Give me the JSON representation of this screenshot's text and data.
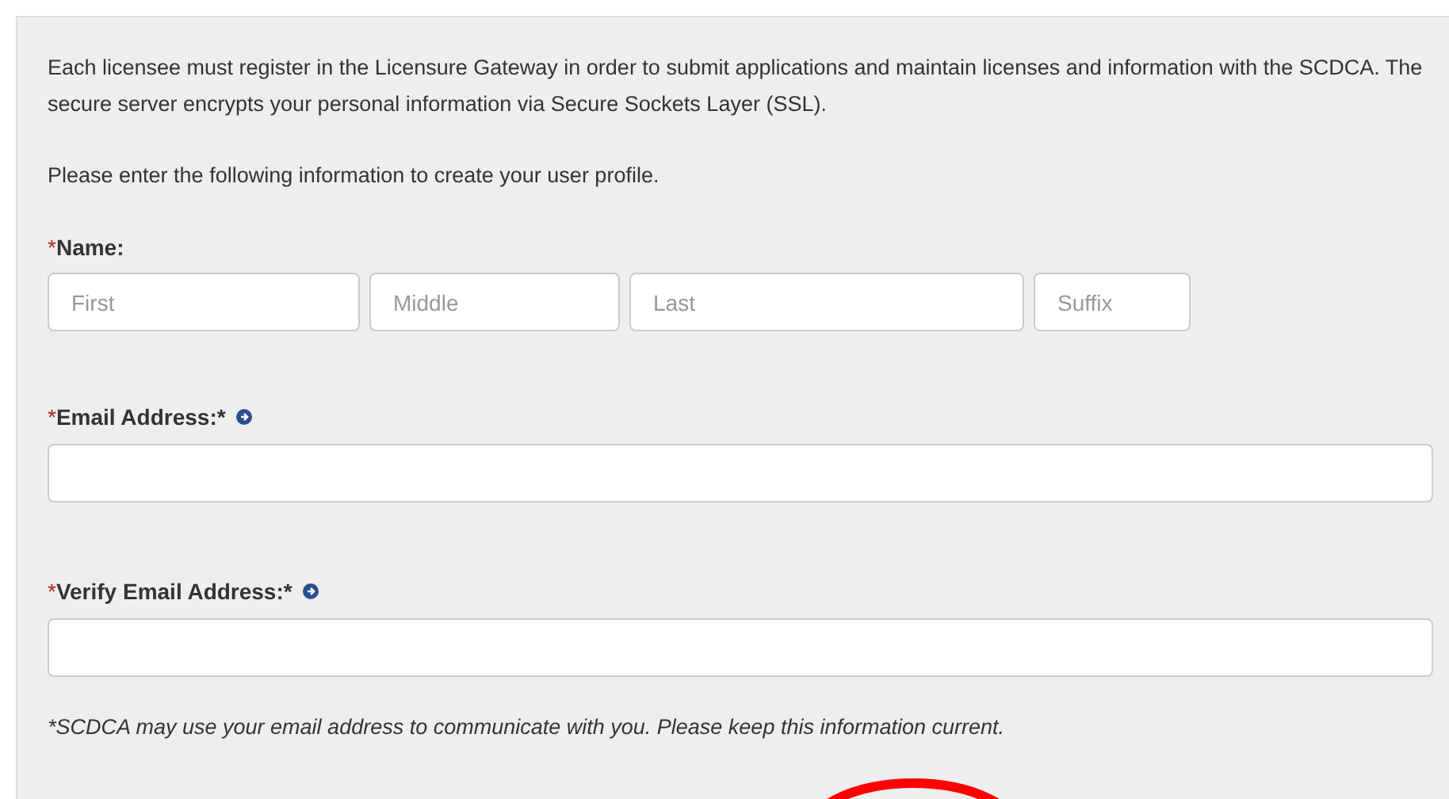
{
  "intro": "Each licensee must register in the Licensure Gateway in order to submit applications and maintain licenses and information with the SCDCA. The secure server encrypts your personal information via Secure Sockets Layer (SSL).",
  "instruction": "Please enter the following information to create your user profile.",
  "name_group": {
    "marker": "*",
    "label": "Name:",
    "fields": [
      {
        "placeholder": "First",
        "kind": "first"
      },
      {
        "placeholder": "Middle",
        "kind": "middle"
      },
      {
        "placeholder": "Last",
        "kind": "last"
      },
      {
        "placeholder": "Suffix",
        "kind": "suffix"
      }
    ]
  },
  "email_fields": [
    {
      "marker": "*",
      "label": "Email Address:*",
      "info": true
    },
    {
      "marker": "*",
      "label": "Verify Email Address:*",
      "info": true
    }
  ],
  "note": "*SCDCA may use your email address to communicate with you. Please keep this information current."
}
